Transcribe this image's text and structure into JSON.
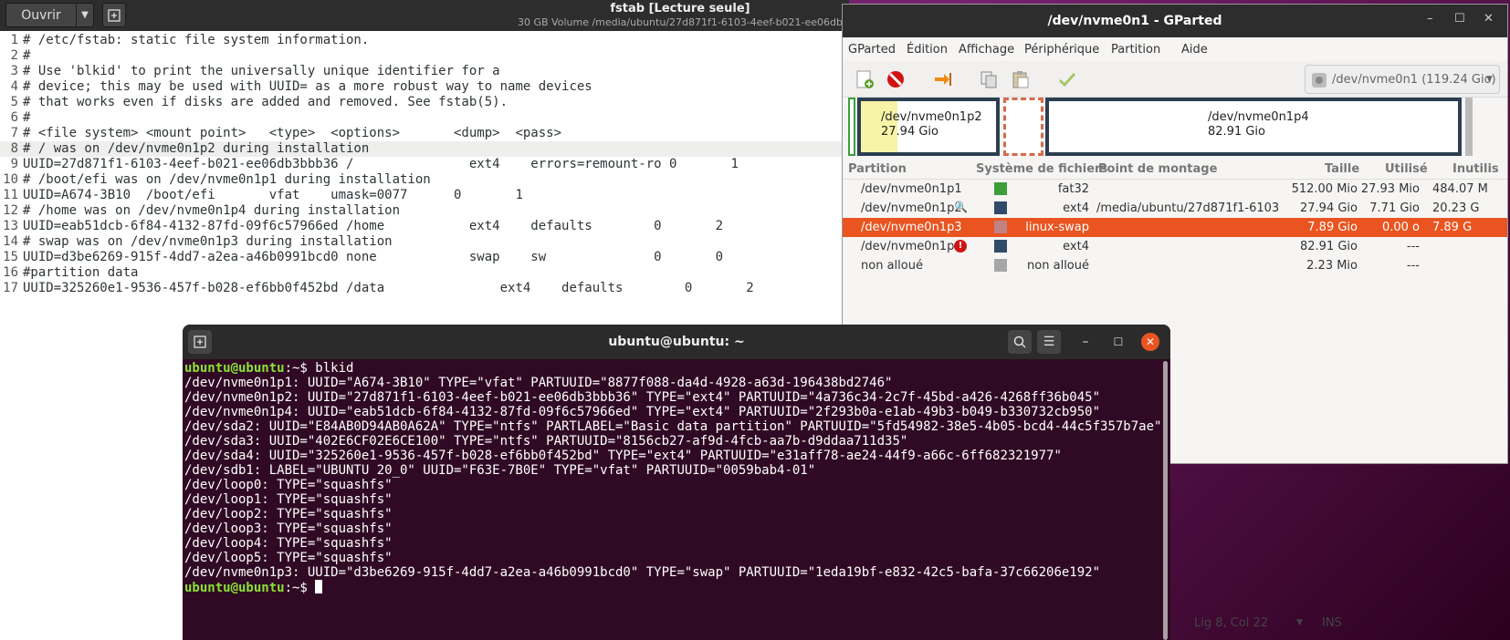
{
  "gedit": {
    "open_label": "Ouvrir",
    "title": "fstab [Lecture seule]",
    "subtitle": "30 GB Volume /media/ubuntu/27d871f1-6103-4eef-b021-ee06db",
    "lines": [
      {
        "n": "1",
        "t": "# /etc/fstab: static file system information."
      },
      {
        "n": "2",
        "t": "#"
      },
      {
        "n": "3",
        "t": "# Use 'blkid' to print the universally unique identifier for a"
      },
      {
        "n": "4",
        "t": "# device; this may be used with UUID= as a more robust way to name devices"
      },
      {
        "n": "5",
        "t": "# that works even if disks are added and removed. See fstab(5)."
      },
      {
        "n": "6",
        "t": "#"
      },
      {
        "n": "7",
        "t": "# <file system> <mount point>   <type>  <options>       <dump>  <pass>"
      },
      {
        "n": "8",
        "t": "# / was on /dev/nvme0n1p2 during installation"
      },
      {
        "n": "9",
        "t": "UUID=27d871f1-6103-4eef-b021-ee06db3bbb36 /               ext4    errors=remount-ro 0       1"
      },
      {
        "n": "10",
        "t": "# /boot/efi was on /dev/nvme0n1p1 during installation"
      },
      {
        "n": "11",
        "t": "UUID=A674-3B10  /boot/efi       vfat    umask=0077      0       1"
      },
      {
        "n": "12",
        "t": "# /home was on /dev/nvme0n1p4 during installation"
      },
      {
        "n": "13",
        "t": "UUID=eab51dcb-6f84-4132-87fd-09f6c57966ed /home           ext4    defaults        0       2"
      },
      {
        "n": "14",
        "t": "# swap was on /dev/nvme0n1p3 during installation"
      },
      {
        "n": "15",
        "t": "UUID=d3be6269-915f-4dd7-a2ea-a46b0991bcd0 none            swap    sw              0       0"
      },
      {
        "n": "16",
        "t": "#partition data"
      },
      {
        "n": "17",
        "t": "UUID=325260e1-9536-457f-b028-ef6bb0f452bd /data               ext4    defaults        0       2"
      }
    ],
    "status_position": "Lig 8, Col 22",
    "status_mode": "INS"
  },
  "gparted": {
    "title": "/dev/nvme0n1 - GParted",
    "menu": [
      "GParted",
      "Édition",
      "Affichage",
      "Périphérique",
      "Partition",
      "Aide"
    ],
    "device": "/dev/nvme0n1 (119.24 Gio)",
    "map": [
      {
        "name": "/dev/nvme0n1p2",
        "size": "27.94 Gio"
      },
      {
        "name": "/dev/nvme0n1p4",
        "size": "82.91 Gio"
      }
    ],
    "columns": [
      "Partition",
      "Système de fichiers",
      "Point de montage",
      "Taille",
      "Utilisé",
      "Inutilis"
    ],
    "rows": [
      {
        "partition": "/dev/nvme0n1p1",
        "fs": "fat32",
        "mount": "",
        "size": "512.00 Mio",
        "used": "27.93 Mio",
        "unused": "484.07 M",
        "color": "#3d9f3a"
      },
      {
        "partition": "/dev/nvme0n1p2",
        "fs": "ext4",
        "mount": "/media/ubuntu/27d871f1-6103-4...",
        "size": "27.94 Gio",
        "used": "7.71 Gio",
        "unused": "20.23 G",
        "color": "#304a6a"
      },
      {
        "partition": "/dev/nvme0n1p3",
        "fs": "linux-swap",
        "mount": "",
        "size": "7.89 Gio",
        "used": "0.00 o",
        "unused": "7.89 G",
        "color": "#c08282"
      },
      {
        "partition": "/dev/nvme0n1p4",
        "fs": "ext4",
        "mount": "",
        "size": "82.91 Gio",
        "used": "---",
        "unused": "",
        "color": "#304a6a"
      },
      {
        "partition": "non alloué",
        "fs": "non alloué",
        "mount": "",
        "size": "2.23 Mio",
        "used": "---",
        "unused": "",
        "color": "#a6a6a6"
      }
    ]
  },
  "terminal": {
    "title": "ubuntu@ubuntu: ~",
    "prompt_user": "ubuntu@ubuntu",
    "prompt_tail": ":~$ ",
    "command": "blkid",
    "output": [
      "/dev/nvme0n1p1: UUID=\"A674-3B10\" TYPE=\"vfat\" PARTUUID=\"8877f088-da4d-4928-a63d-196438bd2746\"",
      "/dev/nvme0n1p2: UUID=\"27d871f1-6103-4eef-b021-ee06db3bbb36\" TYPE=\"ext4\" PARTUUID=\"4a736c34-2c7f-45bd-a426-4268ff36b045\"",
      "/dev/nvme0n1p4: UUID=\"eab51dcb-6f84-4132-87fd-09f6c57966ed\" TYPE=\"ext4\" PARTUUID=\"2f293b0a-e1ab-49b3-b049-b330732cb950\"",
      "/dev/sda2: UUID=\"E84AB0D94AB0A62A\" TYPE=\"ntfs\" PARTLABEL=\"Basic data partition\" PARTUUID=\"5fd54982-38e5-4b05-bcd4-44c5f357b7ae\"",
      "/dev/sda3: UUID=\"402E6CF02E6CE100\" TYPE=\"ntfs\" PARTUUID=\"8156cb27-af9d-4fcb-aa7b-d9ddaa711d35\"",
      "/dev/sda4: UUID=\"325260e1-9536-457f-b028-ef6bb0f452bd\" TYPE=\"ext4\" PARTUUID=\"e31aff78-ae24-44f9-a66c-6ff682321977\"",
      "/dev/sdb1: LABEL=\"UBUNTU 20_0\" UUID=\"F63E-7B0E\" TYPE=\"vfat\" PARTUUID=\"0059bab4-01\"",
      "/dev/loop0: TYPE=\"squashfs\"",
      "/dev/loop1: TYPE=\"squashfs\"",
      "/dev/loop2: TYPE=\"squashfs\"",
      "/dev/loop3: TYPE=\"squashfs\"",
      "/dev/loop4: TYPE=\"squashfs\"",
      "/dev/loop5: TYPE=\"squashfs\"",
      "/dev/nvme0n1p3: UUID=\"d3be6269-915f-4dd7-a2ea-a46b0991bcd0\" TYPE=\"swap\" PARTUUID=\"1eda19bf-e832-42c5-bafa-37c66206e192\""
    ]
  }
}
